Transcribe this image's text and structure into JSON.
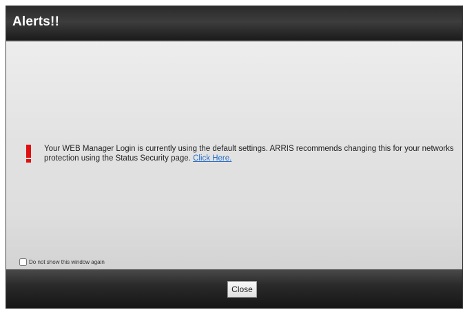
{
  "dialog": {
    "title": "Alerts!!",
    "alert": {
      "icon": "exclamation-icon",
      "message": "Your WEB Manager Login is currently using the default settings. ARRIS recommends changing this for your networks protection using the Status Security page.",
      "link_label": "Click Here."
    },
    "dont_show": {
      "label": "Do not show this window again",
      "checked": false
    },
    "close_label": "Close"
  },
  "colors": {
    "alert_red": "#e01010",
    "link_blue": "#2a6fc9",
    "titlebar": "#2a2a2a"
  }
}
